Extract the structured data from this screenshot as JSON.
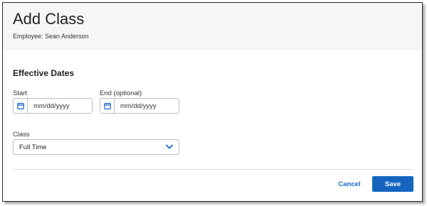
{
  "dialog": {
    "title": "Add Class",
    "subtitle": "Employee: Sean Anderson"
  },
  "effective_dates": {
    "section_title": "Effective Dates",
    "start": {
      "label": "Start",
      "placeholder": "mm/dd/yyyy",
      "icon": "calendar-icon"
    },
    "end": {
      "label": "End (optional)",
      "placeholder": "mm/dd/yyyy",
      "icon": "calendar-icon"
    }
  },
  "class_field": {
    "label": "Class",
    "selected": "Full Time",
    "icon": "chevron-down-icon"
  },
  "actions": {
    "cancel_label": "Cancel",
    "save_label": "Save"
  },
  "colors": {
    "accent": "#1565c0",
    "link": "#1466c8",
    "header_bg": "#f6f6f6"
  }
}
